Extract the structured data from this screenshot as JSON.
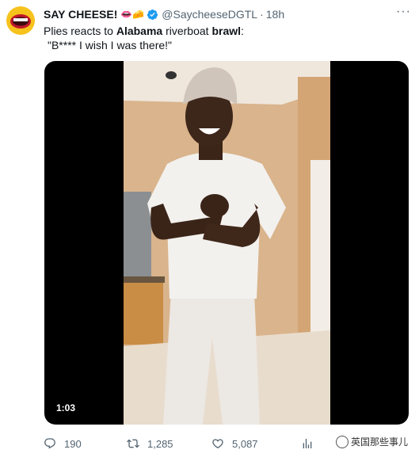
{
  "author": {
    "display_name": "SAY CHEESE!",
    "emojis": "👄🧀",
    "handle": "@SaycheeseDGTL",
    "separator": "·",
    "time": "18h"
  },
  "tweet": {
    "part1": "Plies reacts to ",
    "bold1": "Alabama",
    "part2": " riverboat ",
    "bold2": "brawl",
    "part3": ":",
    "line2": "\"B**** I wish I was there!\""
  },
  "media": {
    "duration": "1:03"
  },
  "actions": {
    "replies": "190",
    "retweets": "1,285",
    "likes": "5,087"
  },
  "watermark": {
    "text": "英国那些事儿"
  },
  "icons": {
    "more": "more-icon",
    "reply": "reply-icon",
    "retweet": "retweet-icon",
    "like": "heart-icon",
    "views": "analytics-icon"
  },
  "colors": {
    "verified": "#1d9bf0",
    "secondary_text": "#536471",
    "avatar_bg": "#f6c21c"
  }
}
